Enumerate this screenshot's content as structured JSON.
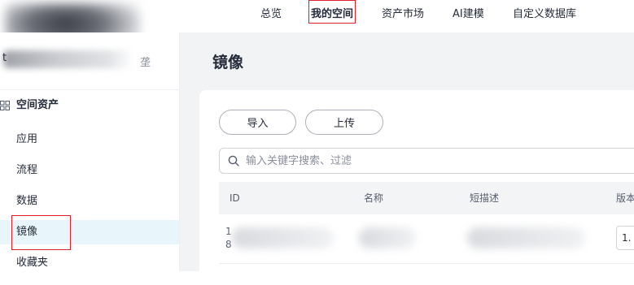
{
  "nav": {
    "items": [
      {
        "label": "总览"
      },
      {
        "label": "我的空间"
      },
      {
        "label": "资产市场"
      },
      {
        "label": "AI建模"
      },
      {
        "label": "自定义数据库"
      }
    ],
    "active_index": 1
  },
  "sidebar": {
    "workspace_prefix": "t",
    "switch_glyph": "垄",
    "group_label": "空间资产",
    "items": [
      {
        "label": "应用"
      },
      {
        "label": "流程"
      },
      {
        "label": "数据"
      },
      {
        "label": "镜像"
      },
      {
        "label": "收藏夹"
      }
    ],
    "active_index": 3
  },
  "main": {
    "title": "镜像",
    "buttons": {
      "import_label": "导入",
      "upload_label": "上传"
    },
    "search": {
      "placeholder": "输入关键字搜索、过滤"
    },
    "table": {
      "columns": [
        "ID",
        "名称",
        "短描述",
        "版本"
      ],
      "rows": [
        {
          "id_prefix_1": "1",
          "id_prefix_2": "8",
          "version_prefix": "1."
        }
      ]
    }
  },
  "colors": {
    "highlight": "#e0202a",
    "active_item_bg": "#e8f5fa",
    "main_bg": "#f2f3f5"
  }
}
